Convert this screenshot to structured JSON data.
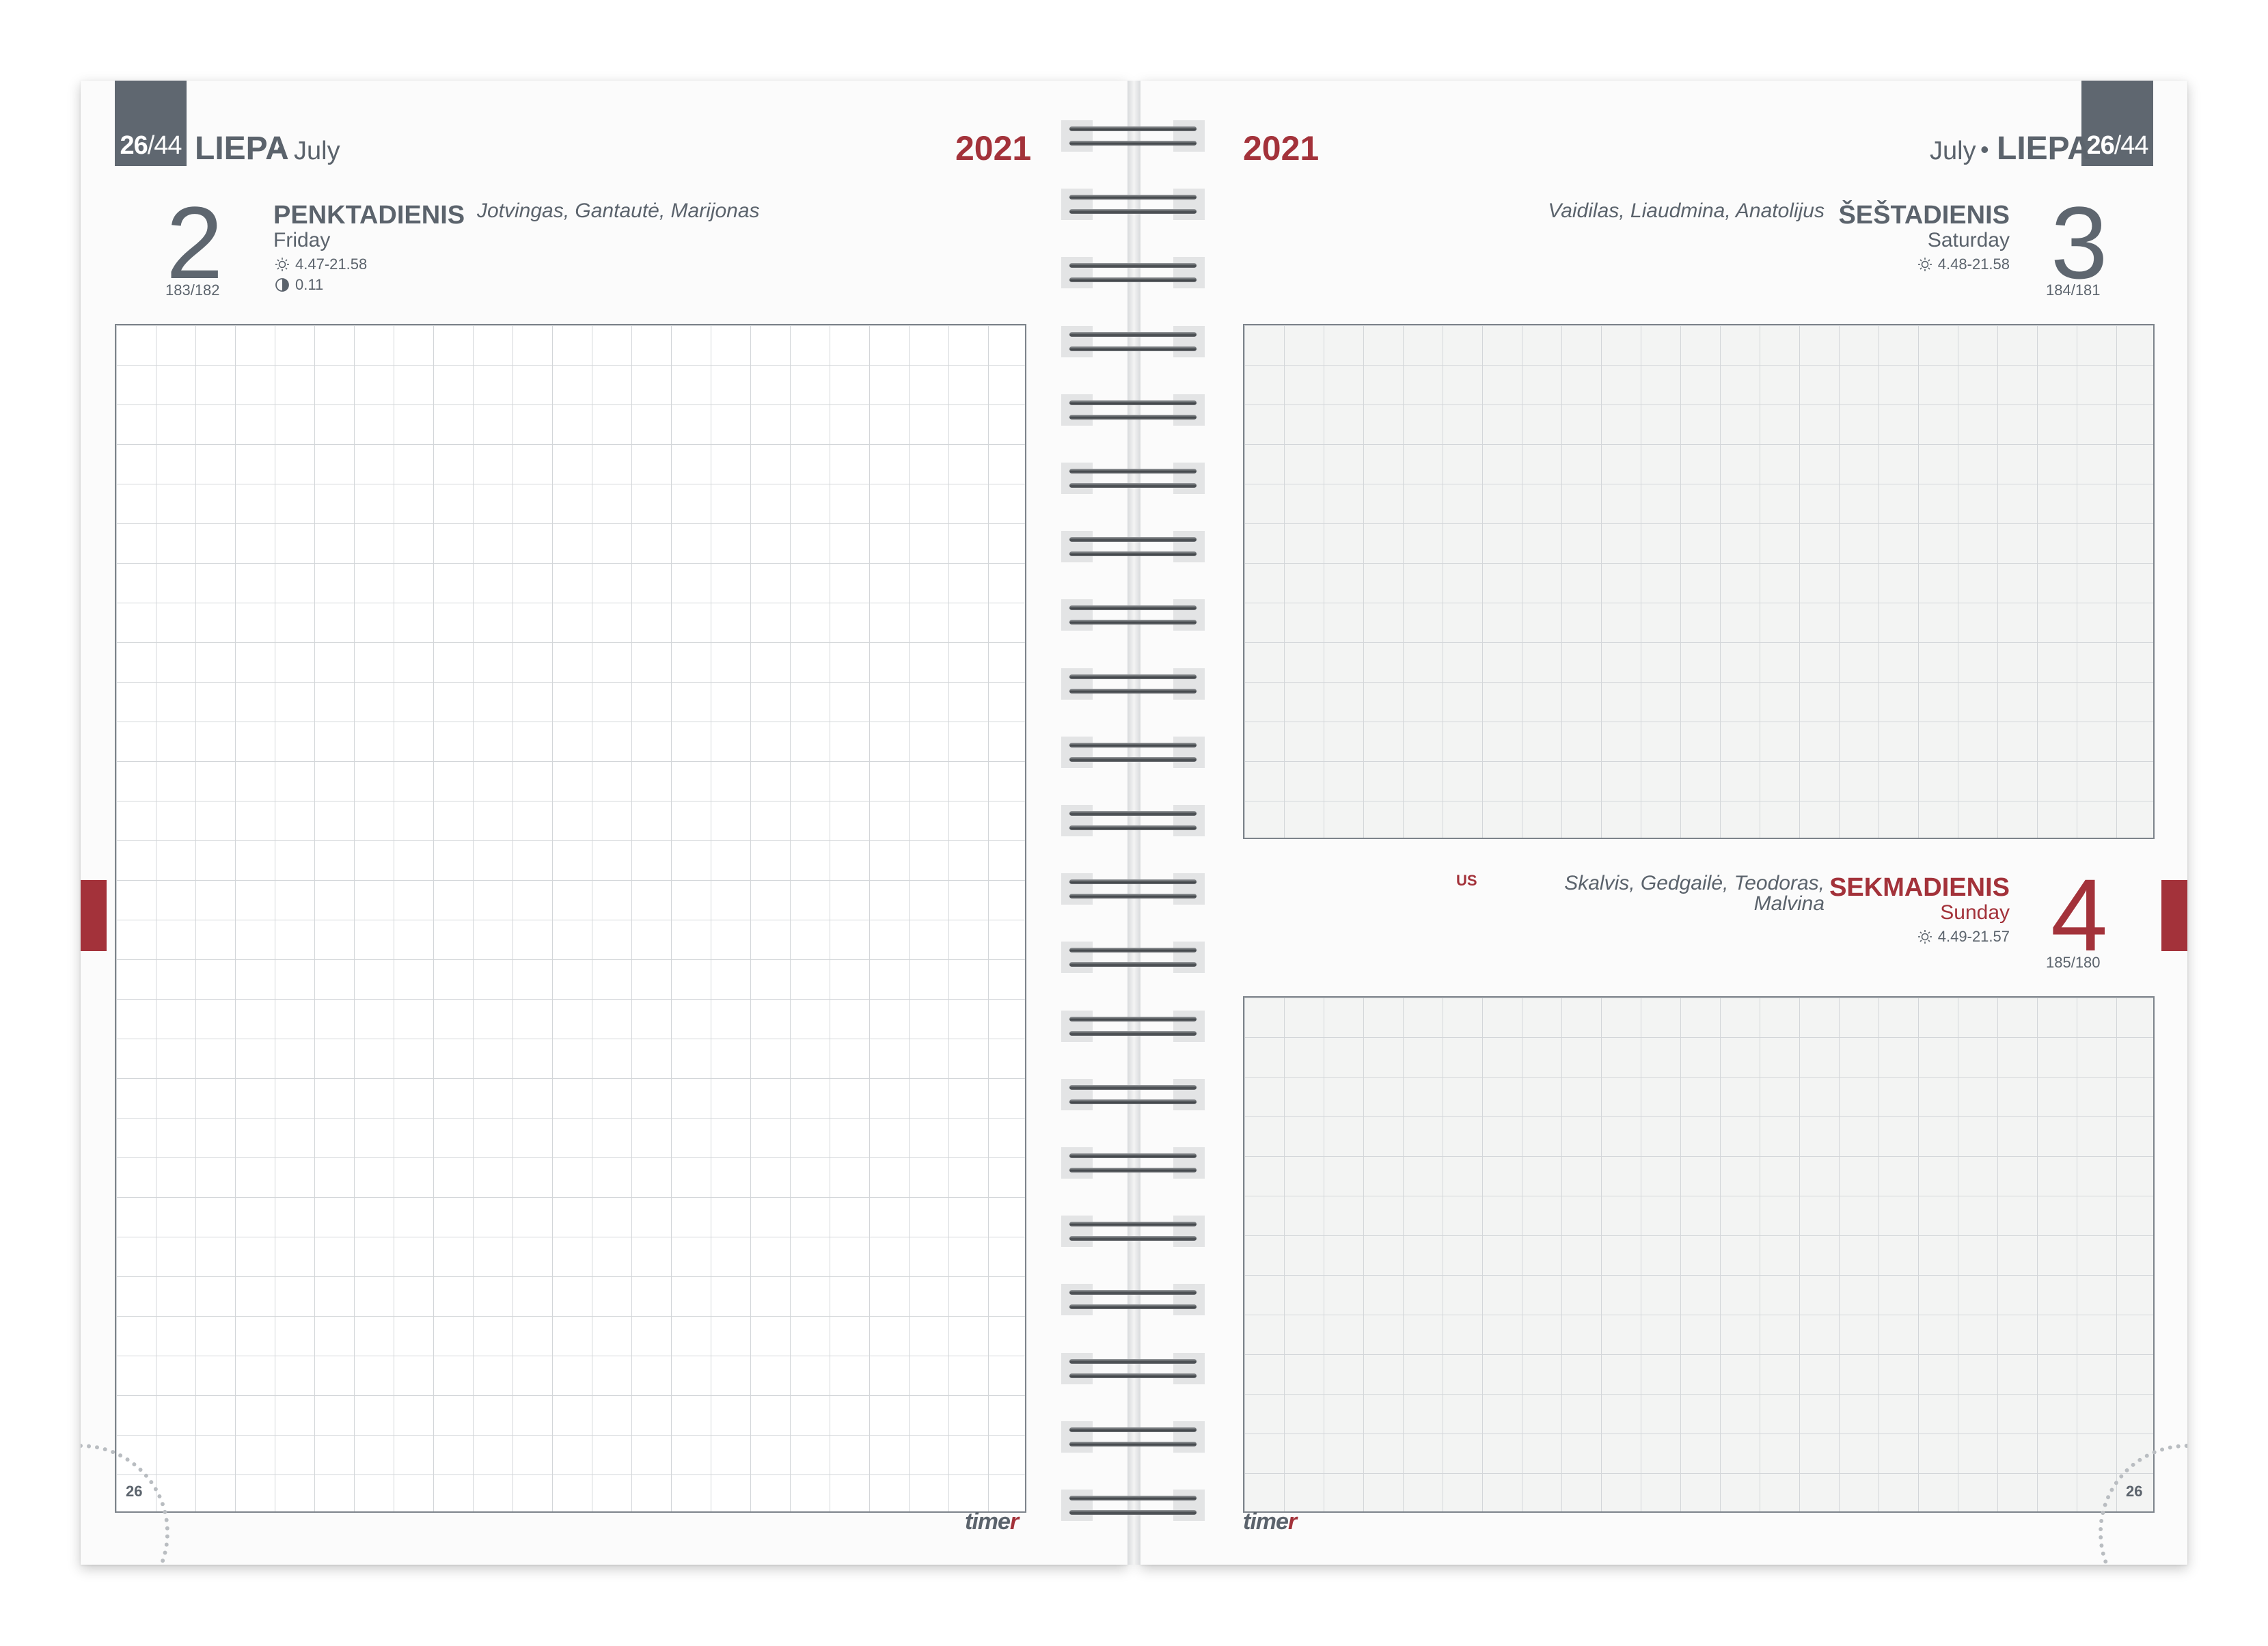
{
  "spread": {
    "week_number": "26",
    "week_separator": "/",
    "weeks_total": "44",
    "month_lt": "LIEPA",
    "month_en": "July",
    "bullet": "•",
    "year": "2021",
    "page_number": "26",
    "brand": "timer",
    "brand_main": "time",
    "brand_accent": "r"
  },
  "left_page": {
    "day": {
      "number": "2",
      "weekday_lt": "PENKTADIENIS",
      "weekday_en": "Friday",
      "day_of_year": "183/182",
      "sun": "4.47-21.58",
      "moon": "0.11",
      "names": "Jotvingas, Gantautė, Marijonas"
    }
  },
  "right_page": {
    "saturday": {
      "number": "3",
      "weekday_lt": "ŠEŠTADIENIS",
      "weekday_en": "Saturday",
      "day_of_year": "184/181",
      "sun": "4.48-21.58",
      "names": "Vaidilas, Liaudmina, Anatolijus"
    },
    "sunday": {
      "number": "4",
      "weekday_lt": "SEKMADIENIS",
      "weekday_en": "Sunday",
      "day_of_year": "185/180",
      "sun": "4.49-21.57",
      "names_line1": "Skalvis, Gedgailė, Teodoras,",
      "names_line2": "Malvina",
      "holiday_code": "US"
    }
  },
  "colors": {
    "accent_red": "#a3323a",
    "text_gray": "#5b636c",
    "tab_gray": "#5f6770"
  },
  "icons": [
    "sun-icon",
    "moon-phase-icon",
    "spiral-binding"
  ]
}
